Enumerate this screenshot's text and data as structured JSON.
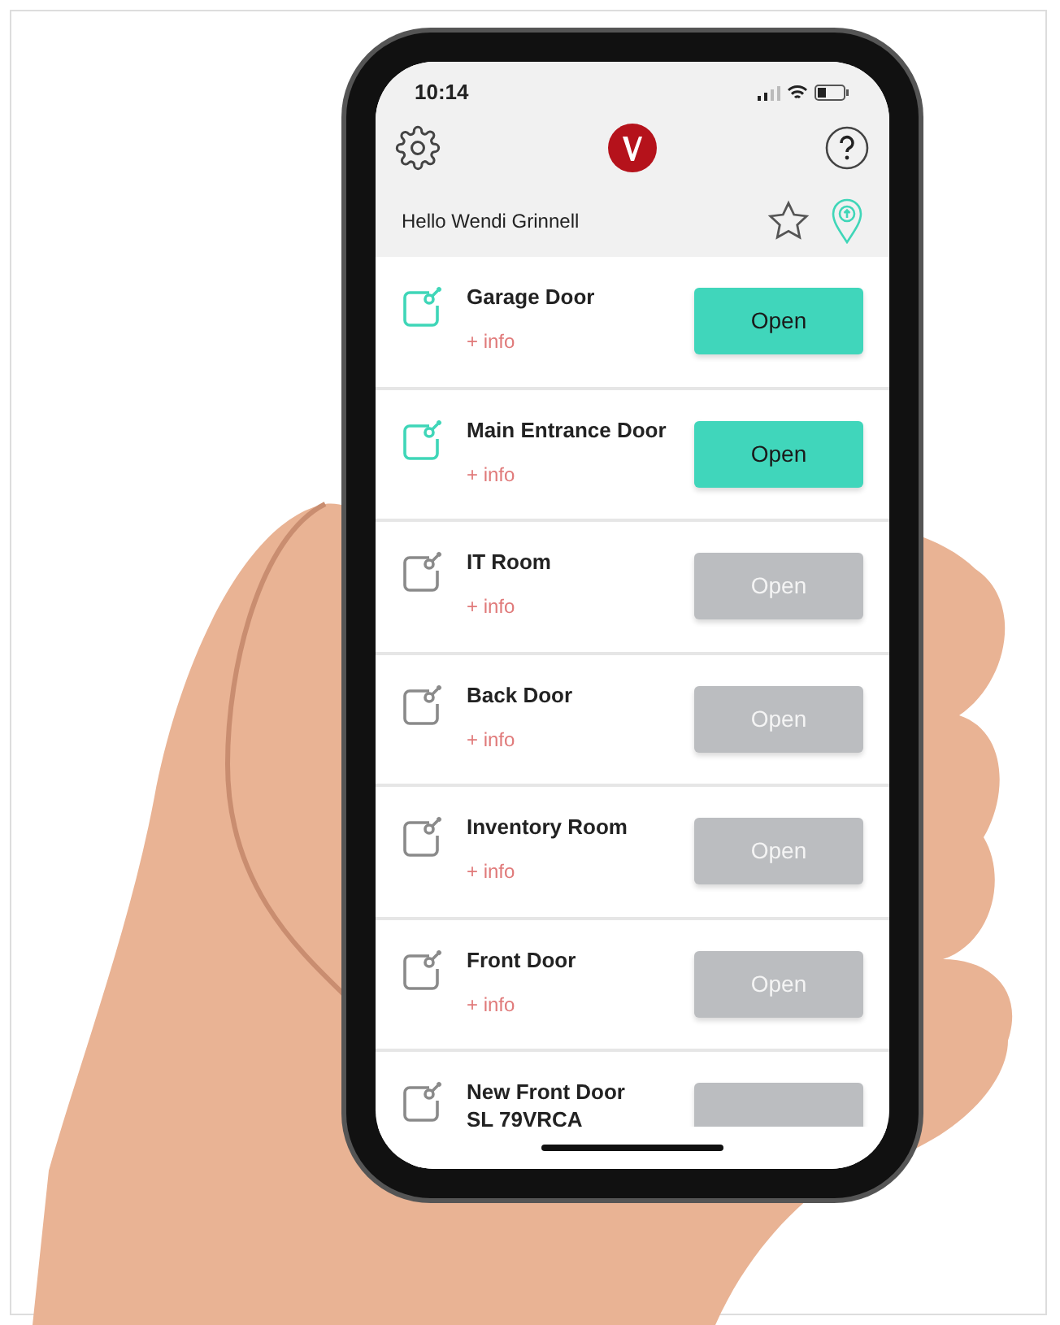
{
  "status_bar": {
    "time": "10:14"
  },
  "greeting": "Hello Wendi Grinnell",
  "doors": [
    {
      "name": "Garage Door",
      "info": "+ info",
      "available": true,
      "button": "Open"
    },
    {
      "name": "Main Entrance Door",
      "info": "+ info",
      "available": true,
      "button": "Open"
    },
    {
      "name": "IT Room",
      "info": "+ info",
      "available": false,
      "button": "Open"
    },
    {
      "name": "Back Door",
      "info": "+ info",
      "available": false,
      "button": "Open"
    },
    {
      "name": "Inventory Room",
      "info": "+ info",
      "available": false,
      "button": "Open"
    },
    {
      "name": "Front Door",
      "info": "+ info",
      "available": false,
      "button": "Open"
    },
    {
      "name": "New Front Door\nSL 79VRCA",
      "available": false
    }
  ]
}
